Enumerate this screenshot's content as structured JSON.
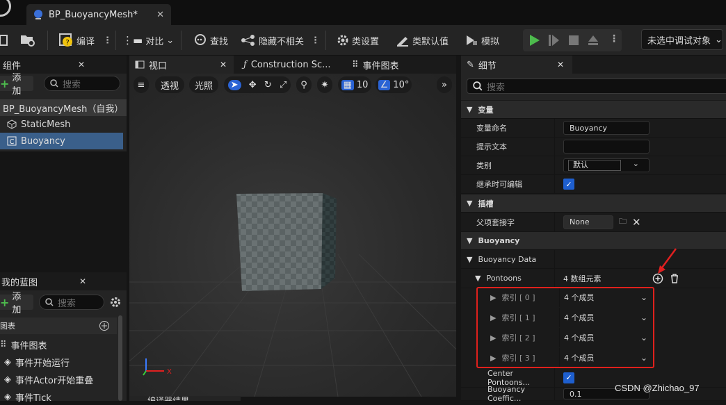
{
  "tab": {
    "title": "BP_BuoyancyMesh*",
    "close": "✕"
  },
  "toolbar": {
    "compile": "编译",
    "diff": "对比",
    "find": "查找",
    "hide_unrelated": "隐藏不相关",
    "class_settings": "类设置",
    "class_defaults": "类默认值",
    "simulate": "模拟",
    "debug_object": "未选中调试对象"
  },
  "components": {
    "title": "组件",
    "close": "✕",
    "add": "添加",
    "search_placeholder": "搜索",
    "items": [
      {
        "label": "BP_BuoyancyMesh（自我）"
      },
      {
        "label": "StaticMesh"
      },
      {
        "label": "Buoyancy"
      }
    ]
  },
  "my_blueprint": {
    "title": "我的蓝图",
    "close": "✕",
    "add": "添加",
    "search_placeholder": "搜索",
    "graphs_header": "图表",
    "items": [
      {
        "label": "事件图表"
      },
      {
        "label": "事件开始运行"
      },
      {
        "label": "事件Actor开始重叠"
      },
      {
        "label": "事件Tick"
      }
    ]
  },
  "editor_tabs": {
    "viewport": "视口",
    "construction": "Construction Sc...",
    "event_graph": "事件图表"
  },
  "viewport_toolbar": {
    "perspective": "透视",
    "lit": "光照",
    "grid_snap": "10",
    "angle_snap": "10°"
  },
  "bottom_tab": "编译器结果",
  "details": {
    "title": "细节",
    "close": "✕",
    "search_placeholder": "搜索",
    "variables_section": "变量",
    "var_name_label": "变量命名",
    "var_name_value": "Buoyancy",
    "tooltip_label": "提示文本",
    "tooltip_value": "",
    "category_label": "类别",
    "category_value": "默认",
    "editable_label": "继承时可编辑",
    "sockets_section": "插槽",
    "parent_socket_label": "父项套接字",
    "parent_socket_value": "None",
    "buoyancy_section": "Buoyancy",
    "buoyancy_data_label": "Buoyancy Data",
    "pontoons_label": "Pontoons",
    "pontoons_value": "4 数组元素",
    "indices": [
      {
        "label": "索引 [ 0 ]",
        "value": "4 个成员"
      },
      {
        "label": "索引 [ 1 ]",
        "value": "4 个成员"
      },
      {
        "label": "索引 [ 2 ]",
        "value": "4 个成员"
      },
      {
        "label": "索引 [ 3 ]",
        "value": "4 个成员"
      }
    ],
    "center_pontoons_label": "Center Pontoons...",
    "buoyancy_coeff_label": "Buoyancy Coeffic...",
    "buoyancy_coeff_value": "0.1"
  },
  "watermark": "CSDN @Zhichao_97"
}
